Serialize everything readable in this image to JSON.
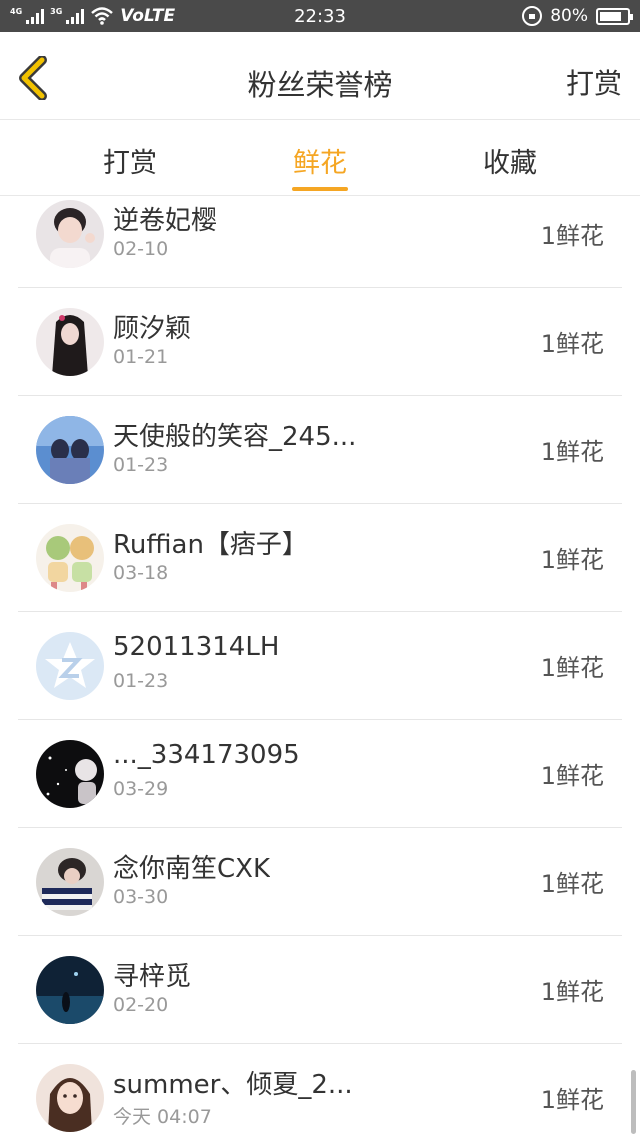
{
  "status_bar": {
    "net1": "4G",
    "net2": "3G",
    "volte": "VoLTE",
    "time": "22:33",
    "battery": "80%"
  },
  "nav": {
    "title": "粉丝荣誉榜",
    "action": "打赏"
  },
  "tabs": [
    {
      "label": "打赏",
      "active": false
    },
    {
      "label": "鲜花",
      "active": true
    },
    {
      "label": "收藏",
      "active": false
    }
  ],
  "rows": [
    {
      "name": "逆卷妃樱",
      "date": "02-10",
      "value": "1鲜花",
      "avatar": "avatar-girl-peace"
    },
    {
      "name": "顾汐颖",
      "date": "01-21",
      "value": "1鲜花",
      "avatar": "avatar-girl-dark-hair"
    },
    {
      "name": "天使般的笑容_245...",
      "date": "01-23",
      "value": "1鲜花",
      "avatar": "avatar-couple-blue"
    },
    {
      "name": "Ruffian【痞子】",
      "date": "03-18",
      "value": "1鲜花",
      "avatar": "avatar-cartoon-pair"
    },
    {
      "name": "52011314LH",
      "date": "01-23",
      "value": "1鲜花",
      "avatar": "avatar-default-star"
    },
    {
      "name": "..._334173095",
      "date": "03-29",
      "value": "1鲜花",
      "avatar": "avatar-dark-sparkle"
    },
    {
      "name": "念你南笙CXK",
      "date": "03-30",
      "value": "1鲜花",
      "avatar": "avatar-striped-girl"
    },
    {
      "name": "寻梓觅",
      "date": "02-20",
      "value": "1鲜花",
      "avatar": "avatar-night-sky"
    },
    {
      "name": "summer、倾夏_2...",
      "date": "今天 04:07",
      "value": "1鲜花",
      "avatar": "avatar-girl-portrait"
    }
  ],
  "colors": {
    "accent": "#f5a623",
    "status_bar": "#4a4a4a",
    "back_arrow": "#f2c200"
  }
}
